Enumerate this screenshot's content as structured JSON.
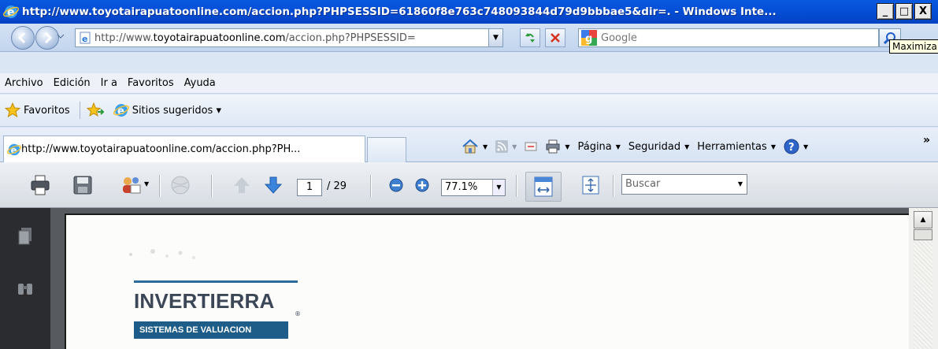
{
  "window": {
    "title": "http://www.toyotairapuatoonline.com/accion.php?PHPSESSID=61860f8e763c748093844d79d9bbbae5&dir=. - Windows Inte...",
    "minimize": "_",
    "maximize": "□",
    "close": "X",
    "tooltip": "Maximizar"
  },
  "addressbar": {
    "url_prefix": "http://www.",
    "url_domain": "toyotairapuatoonline.com",
    "url_suffix": "/accion.php?PHPSESSID="
  },
  "search": {
    "placeholder": "Google"
  },
  "menu": {
    "items": [
      "Archivo",
      "Edición",
      "Ir a",
      "Favoritos",
      "Ayuda"
    ]
  },
  "favorites": {
    "favorites_label": "Favoritos",
    "suggested_label": "Sitios sugeridos ▾"
  },
  "tabs": {
    "active_title": "http://www.toyotairapuatoonline.com/accion.php?PH..."
  },
  "commands": {
    "page": "Página",
    "security": "Seguridad",
    "tools": "Herramientas",
    "more": "»"
  },
  "pdf_toolbar": {
    "current_page": "1",
    "page_count": "/ 29",
    "zoom": "77.1%",
    "search_placeholder": "Buscar"
  },
  "document": {
    "logo_name": "INVERTIERRA",
    "logo_registered": "®",
    "logo_tagline": "SISTEMAS DE VALUACION"
  },
  "colors": {
    "titlebar": "#0550d8",
    "logo_blue": "#1e5d88",
    "logo_text": "#3b4656"
  }
}
